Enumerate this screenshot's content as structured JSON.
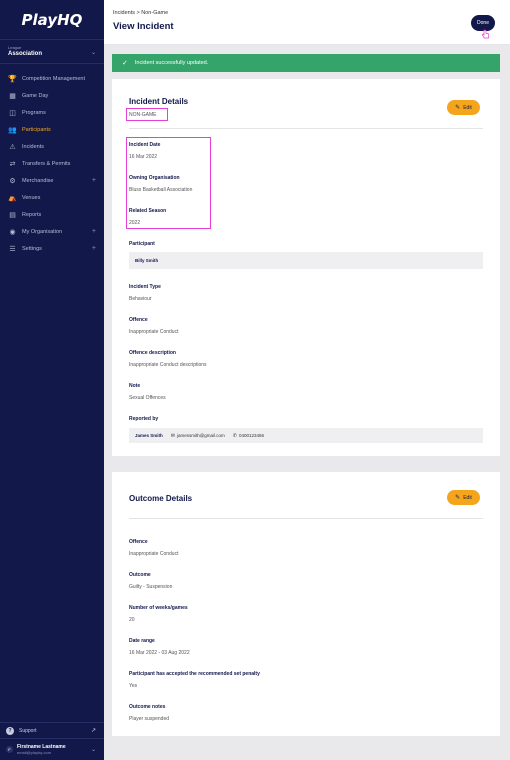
{
  "sidebar": {
    "logo": "PlayHQ",
    "context_label": "League",
    "context_value": "Association",
    "items": [
      {
        "label": "Competition Management",
        "icon": "trophy-icon",
        "plus": false,
        "active": false
      },
      {
        "label": "Game Day",
        "icon": "scoreboard-icon",
        "plus": false,
        "active": false
      },
      {
        "label": "Programs",
        "icon": "book-icon",
        "plus": false,
        "active": false
      },
      {
        "label": "Participants",
        "icon": "people-icon",
        "plus": false,
        "active": true
      },
      {
        "label": "Incidents",
        "icon": "warning-icon",
        "plus": false,
        "active": false
      },
      {
        "label": "Transfers & Permits",
        "icon": "transfer-icon",
        "plus": false,
        "active": false
      },
      {
        "label": "Merchandise",
        "icon": "tag-icon",
        "plus": true,
        "active": false
      },
      {
        "label": "Venues",
        "icon": "venue-icon",
        "plus": false,
        "active": false
      },
      {
        "label": "Reports",
        "icon": "report-icon",
        "plus": false,
        "active": false
      },
      {
        "label": "My Organisation",
        "icon": "globe-icon",
        "plus": true,
        "active": false
      },
      {
        "label": "Settings",
        "icon": "sliders-icon",
        "plus": true,
        "active": false
      }
    ],
    "support_label": "Support",
    "user_initial": "F",
    "user_name": "Firstname Lastname",
    "user_email": "email@playhq.com"
  },
  "header": {
    "breadcrumb": "Incidents > Non-Game",
    "title": "View Incident",
    "done_label": "Done"
  },
  "alert": {
    "message": "Incident successfully updated."
  },
  "incident": {
    "heading": "Incident Details",
    "edit_label": "Edit",
    "category": "NON-GAME",
    "fields": {
      "incident_date_label": "Incident Date",
      "incident_date": "16 Mar 2022",
      "owning_org_label": "Owning Organisation",
      "owning_org": "Bluss Basketball Association",
      "season_label": "Related Season",
      "season": "2022",
      "participant_label": "Participant",
      "participant": "Billy Smith",
      "type_label": "Incident Type",
      "type": "Behaviour",
      "offence_label": "Offence",
      "offence": "Inappropriate Conduct",
      "offence_desc_label": "Offence description",
      "offence_desc": "Inappropriate Conduct descriptions",
      "note_label": "Note",
      "note": "Sexual Offences",
      "reported_by_label": "Reported by",
      "reporter_name": "James Smith",
      "reporter_email": "jamessmith@gmail.com",
      "reporter_phone": "0400123456"
    }
  },
  "outcome": {
    "heading": "Outcome Details",
    "edit_label": "Edit",
    "offence_label": "Offence",
    "offence": "Inappropriate Conduct",
    "outcome_label": "Outcome",
    "outcome": "Guilty - Suspension",
    "weeks_label": "Number of weeks/games",
    "weeks": "20",
    "date_range_label": "Date range",
    "date_range": "16 Mar 2022 - 03 Aug 2022",
    "accepted_label": "Participant has accepted the recommended set penalty",
    "accepted": "Yes",
    "notes_label": "Outcome notes",
    "notes": "Player suspended"
  },
  "colors": {
    "navy": "#12184a",
    "accent": "#f4a51c",
    "success": "#34a46a",
    "highlight": "#e53fd6"
  }
}
